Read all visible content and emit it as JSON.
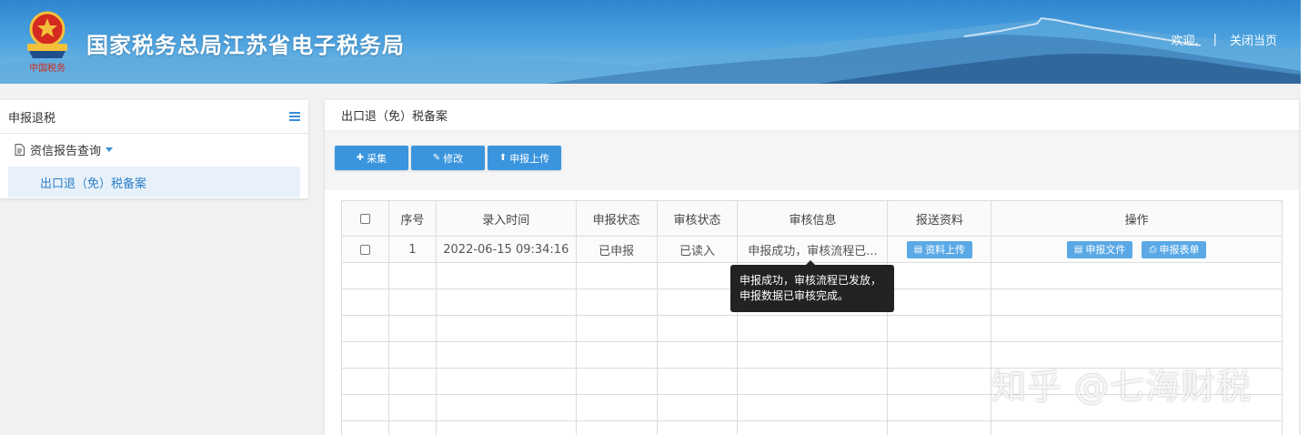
{
  "header": {
    "title": "国家税务总局江苏省电子税务局",
    "welcome": "欢迎,",
    "separator": "|",
    "close_label": "关闭当页"
  },
  "sidebar": {
    "title": "申报退税",
    "group_label": "资信报告查询",
    "sub_item_label": "出口退（免）税备案"
  },
  "main": {
    "title": "出口退（免）税备案",
    "buttons": {
      "collect": "采集",
      "edit": "修改",
      "upload": "申报上传"
    },
    "table": {
      "headers": {
        "seq": "序号",
        "time": "录入时间",
        "report_status": "申报状态",
        "audit_status": "审核状态",
        "audit_info": "审核信息",
        "materials": "报送资料",
        "ops": "操作"
      },
      "row": {
        "seq": "1",
        "time": "2022-06-15 09:34:16",
        "report_status": "已申报",
        "audit_status": "已读入",
        "audit_info": "申报成功，审核流程已...",
        "materials_btn": "资料上传",
        "file_btn": "申报文件",
        "form_btn": "申报表单"
      }
    },
    "tooltip": "申报成功，审核流程已发放，申报数据已审核完成。"
  },
  "watermark": "知乎 @七海财税",
  "colors": {
    "accent": "#3a95de",
    "header_bg": "#2f86cf",
    "tooltip_bg": "#222222"
  }
}
